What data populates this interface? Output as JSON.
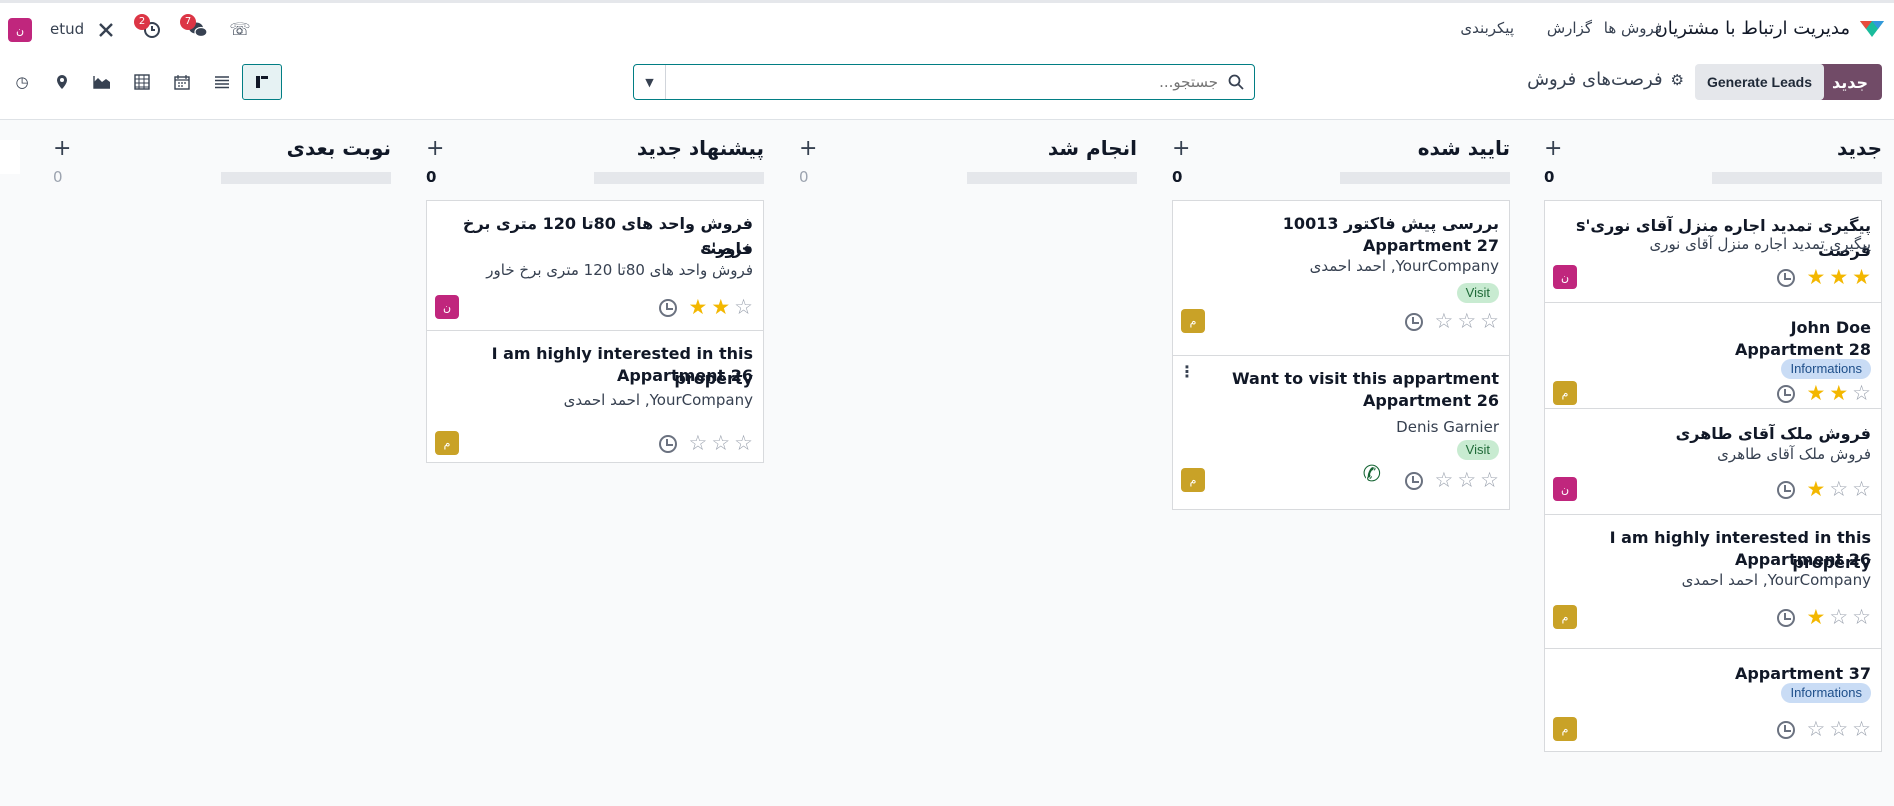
{
  "app": {
    "name": "مدیریت ارتباط با مشتریان",
    "menu": [
      "فروش ها",
      "گزارش",
      "پیکربندی"
    ],
    "user": "etud",
    "user_avatar": "ن",
    "activity_badge": "2",
    "messages_badge": "7"
  },
  "control": {
    "new_label": "جدید",
    "generate_label": "Generate Leads",
    "breadcrumb": "فرصت‌های فروش",
    "search_placeholder": "جستجو..."
  },
  "views": [
    "kanban-view-icon",
    "list-view-icon",
    "calendar-view-icon",
    "pivot-view-icon",
    "graph-view-icon",
    "map-view-icon",
    "activity-view-icon"
  ],
  "colors": {
    "brand": "#714b67",
    "accent": "#017e84",
    "star": "#f3b700",
    "avatar_pink": "#c0267d",
    "avatar_gold": "#c9a227"
  },
  "columns": [
    {
      "title": "جدید",
      "count": "0",
      "cards": [
        {
          "title": "پیگیری تمدید اجاره منزل آقای نوری's فرصت",
          "sub": "پیگیری تمدید اجاره منزل آقای نوری",
          "stars": 3,
          "avatar": "ن"
        },
        {
          "title": "John Doe",
          "title2": "Appartment 28",
          "tag": "Informations",
          "stars": 2,
          "avatar": "م"
        },
        {
          "title": "فروش ملک آقای طاهری",
          "sub": "فروش ملک آقای طاهری",
          "stars": 1,
          "avatar": "ن"
        },
        {
          "title": "I am highly interested in this property",
          "title2": "Appartment 26",
          "sub": "YourCompany, احمد احمدی",
          "stars": 1,
          "avatar": "م"
        },
        {
          "title": "Appartment 37",
          "tag": "Informations",
          "stars": 0,
          "avatar": "م"
        }
      ]
    },
    {
      "title": "تایید شده",
      "count": "0",
      "cards": [
        {
          "title": "بررسی پیش فاکتور 10013",
          "title2": "Appartment 27",
          "sub": "YourCompany, احمد احمدی",
          "tag": "Visit",
          "stars": 0,
          "avatar": "م"
        },
        {
          "title": "Want to visit this appartment",
          "title2": "Appartment 26",
          "sub": "Denis Garnier",
          "tag": "Visit",
          "stars": 0,
          "avatar": "م"
        }
      ]
    },
    {
      "title": "انجام شد",
      "count": "0",
      "cards": []
    },
    {
      "title": "پیشنهاد جدید",
      "count": "0",
      "cards": [
        {
          "title": "فروش واحد های 80تا 120 متری برخ خاور's",
          "title_line2": "فرصت",
          "sub": "فروش واحد های 80تا 120 متری برخ خاور",
          "stars": 2,
          "avatar": "ن"
        },
        {
          "title": "I am highly interested in this property",
          "title2": "Appartment 26",
          "sub": "YourCompany, احمد احمدی",
          "stars": 0,
          "avatar": "م"
        }
      ]
    },
    {
      "title": "نوبت بعدی",
      "count": "0",
      "cards": []
    }
  ]
}
